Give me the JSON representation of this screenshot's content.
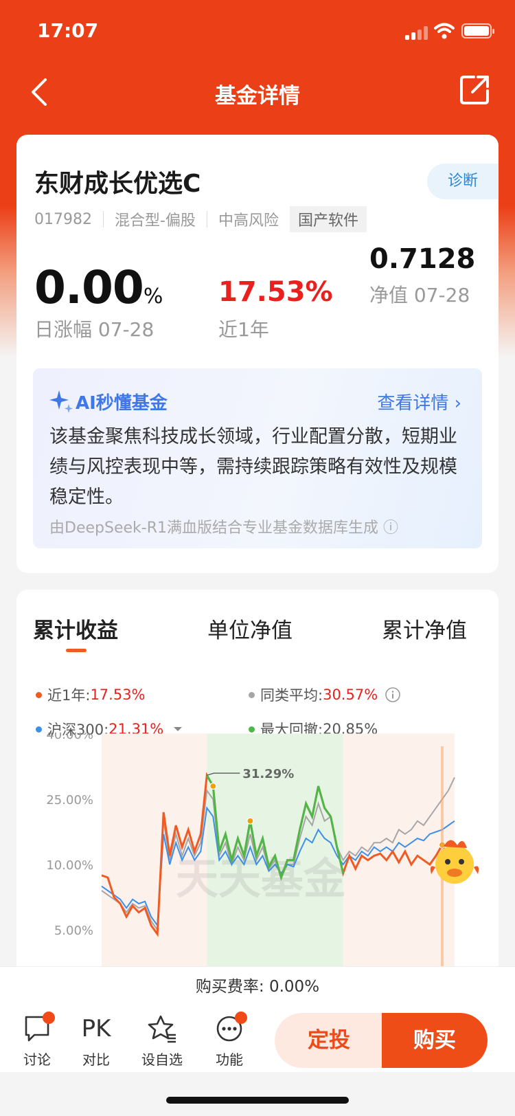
{
  "status_bar": {
    "time": "17:07"
  },
  "nav": {
    "title": "基金详情"
  },
  "fund": {
    "name": "东财成长优选C",
    "diagnose": "诊断",
    "code": "017982",
    "type": "混合型-偏股",
    "risk": "中高风险",
    "theme": "国产软件",
    "daily_change": "0.00",
    "daily_unit": "%",
    "daily_label": "日涨幅 07-28",
    "year_return": "17.53%",
    "year_label": "近1年",
    "nav_value": "0.7128",
    "nav_label": "净值 07-28"
  },
  "ai": {
    "title": "AI秒懂基金",
    "more": "查看详情 ›",
    "description": "该基金聚焦科技成长领域，行业配置分散，短期业绩与风控表现中等，需持续跟踪策略有效性及规模稳定性。",
    "source": "由DeepSeek-R1满血版结合专业基金数据库生成 ⓘ"
  },
  "tabs": [
    "累计收益",
    "单位净值",
    "累计净值"
  ],
  "legend": {
    "fund_label": "近1年:",
    "fund_value": "17.53%",
    "peer_label": "同类平均:",
    "peer_value": "30.57%",
    "index_label": "沪深300:",
    "index_value": "21.31%",
    "drawdown_label": "最大回撤:",
    "drawdown_value": "20.85%"
  },
  "colors": {
    "fund": "#f05a23",
    "peer": "#a6a6a6",
    "index": "#3d8fe8",
    "drawdown": "#4cb84a",
    "accent": "#eb3f17"
  },
  "chart_data": {
    "type": "line",
    "y_ticks": [
      "40.00%",
      "25.00%",
      "10.00%",
      "5.00%"
    ],
    "ylim": [
      -5,
      40
    ],
    "annotation": "31.29%",
    "watermark": "天天基金",
    "grid": true,
    "series": [
      {
        "name": "近1年",
        "values": [
          7.5,
          7,
          2.5,
          1,
          -2,
          0.5,
          -1,
          0,
          -4,
          -6,
          22,
          12,
          19,
          14,
          18,
          13,
          17,
          30.5,
          28,
          13,
          17,
          11,
          16,
          12,
          20,
          12,
          16,
          9.5,
          12,
          7,
          11,
          11,
          18,
          24,
          21,
          28,
          23,
          21,
          14,
          8,
          12,
          9,
          12,
          11,
          12,
          12.5,
          11,
          13,
          10.5,
          13,
          10,
          12,
          11,
          10,
          12,
          14.5,
          12,
          13
        ]
      },
      {
        "name": "同类平均",
        "values": [
          4,
          3,
          2,
          1,
          -1,
          1,
          0,
          0.5,
          -3,
          -5,
          20,
          11,
          17,
          12,
          16,
          12,
          15,
          27,
          25,
          12,
          15,
          10,
          14,
          11,
          17,
          11,
          14,
          9,
          11,
          7,
          10,
          10,
          16,
          21,
          19,
          24,
          20,
          21,
          14,
          11,
          13,
          12,
          14,
          13,
          15,
          15,
          16,
          15,
          18,
          17,
          18,
          20,
          19,
          21,
          23,
          25,
          27,
          30
        ]
      },
      {
        "name": "沪深300",
        "values": [
          5,
          4,
          3,
          2,
          0,
          2,
          1,
          1.5,
          -2,
          -4,
          17,
          10,
          15,
          11,
          14,
          11,
          13,
          23,
          21,
          11,
          13,
          10,
          12,
          10,
          14,
          10,
          12,
          8.5,
          10,
          8,
          10,
          9.5,
          13,
          16,
          15,
          18,
          16,
          15,
          12,
          10,
          12,
          11,
          13,
          12,
          14,
          13,
          14,
          13,
          15,
          14,
          15,
          16,
          15.5,
          17,
          17.5,
          18,
          19,
          20
        ]
      },
      {
        "name": "最大回撤",
        "values": [
          30.5,
          28,
          13,
          17,
          11,
          16,
          12,
          20,
          12,
          16,
          9.5,
          12,
          7,
          11,
          11,
          18,
          24,
          21,
          28,
          23,
          21,
          14,
          8
        ]
      }
    ]
  },
  "fee": {
    "text": "购买费率: 0.00%"
  },
  "bottom_bar": {
    "discuss": "讨论",
    "compare_icon": "PK",
    "compare": "对比",
    "watchlist": "设自选",
    "functions": "功能",
    "invest": "定投",
    "buy": "购买"
  }
}
